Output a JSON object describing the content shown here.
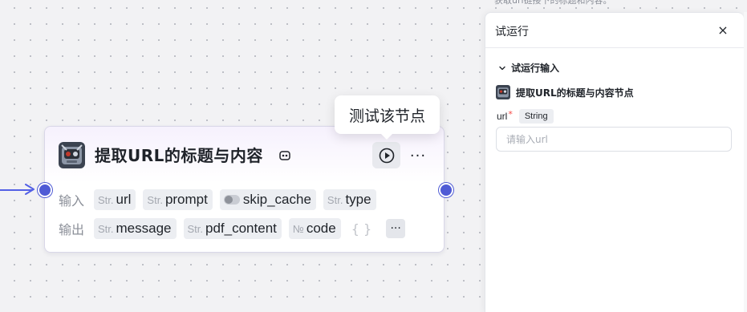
{
  "top_description": "获取url链接下的标题和内容。",
  "node": {
    "title": "提取URL的标题与内容",
    "title_badge_icon": "plugin-badge-icon",
    "icon": "robot-avatar-icon",
    "run_icon": "play-circle-icon",
    "more_label": "···",
    "inputs_label": "输入",
    "outputs_label": "输出",
    "inputs": [
      {
        "type": "Str.",
        "name": "url"
      },
      {
        "type": "Str.",
        "name": "prompt"
      },
      {
        "type": "toggle",
        "name": "skip_cache"
      },
      {
        "type": "Str.",
        "name": "type"
      }
    ],
    "outputs": [
      {
        "type": "Str.",
        "name": "message"
      },
      {
        "type": "Str.",
        "name": "pdf_content"
      },
      {
        "type": "№",
        "name": "code"
      }
    ],
    "outputs_brace": "{ }",
    "outputs_more_label": "···"
  },
  "tooltip": {
    "text": "测试该节点"
  },
  "panel": {
    "title": "试运行",
    "close_label": "×",
    "section_label": "试运行输入",
    "node_ref_title": "提取URL的标题与内容节点",
    "field": {
      "name": "url",
      "required_mark": "*",
      "type_tag": "String",
      "placeholder": "请输入url",
      "value": ""
    }
  },
  "colors": {
    "accent": "#4f5bd5",
    "edge": "#5360e5",
    "required": "#f54a45"
  }
}
